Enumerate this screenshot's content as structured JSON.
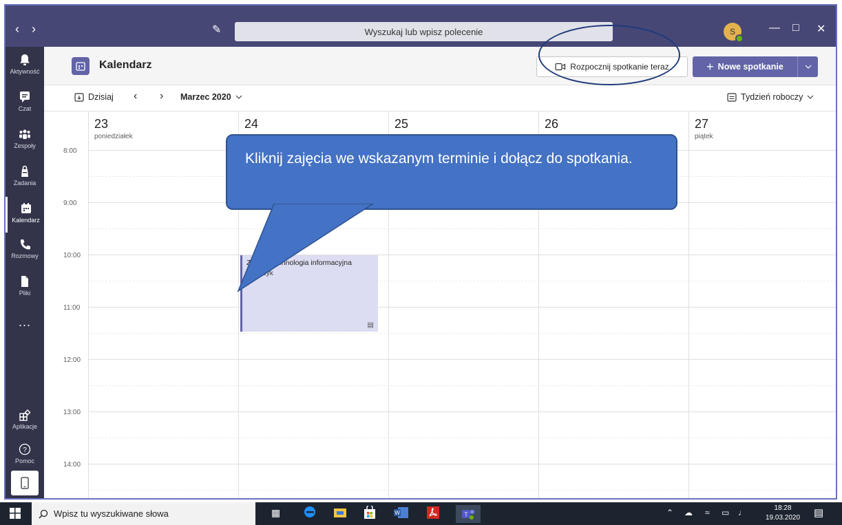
{
  "topbar": {
    "search_placeholder": "Wyszukaj lub wpisz polecenie",
    "avatar_initial": "S"
  },
  "rail": {
    "items": [
      {
        "label": "Aktywność",
        "icon": "bell-icon"
      },
      {
        "label": "Czat",
        "icon": "chat-icon"
      },
      {
        "label": "Zespoły",
        "icon": "teams-icon"
      },
      {
        "label": "Zadania",
        "icon": "assignments-icon"
      },
      {
        "label": "Kalendarz",
        "icon": "calendar-icon"
      },
      {
        "label": "Rozmowy",
        "icon": "phone-icon"
      },
      {
        "label": "Pliki",
        "icon": "file-icon"
      }
    ],
    "more": "...",
    "bottom": [
      {
        "label": "Aplikacje",
        "icon": "apps-icon"
      },
      {
        "label": "Pomoc",
        "icon": "help-icon"
      }
    ]
  },
  "header": {
    "title": "Kalendarz",
    "meet_now": "Rozpocznij spotkanie teraz",
    "new_meeting": "Nowe spotkanie"
  },
  "toolbar": {
    "today": "Dzisiaj",
    "month": "Marzec 2020",
    "view": "Tydzień roboczy"
  },
  "days": [
    {
      "num": "23",
      "name": "poniedziałek"
    },
    {
      "num": "24",
      "name": ""
    },
    {
      "num": "25",
      "name": ""
    },
    {
      "num": "26",
      "name": ""
    },
    {
      "num": "27",
      "name": "piątek"
    }
  ],
  "times": [
    "8:00",
    "9:00",
    "10:00",
    "11:00",
    "12:00",
    "13:00",
    "14:00"
  ],
  "event": {
    "title": "Zajęcia technologia informacyjna",
    "organizer": "stańczyk"
  },
  "callout": {
    "text": "Kliknij zajęcia we wskazanym terminie i dołącz do spotkania."
  },
  "taskbar": {
    "search": "Wpisz tu wyszukiwane słowa",
    "time": "18:28",
    "date": "19.03.2020"
  },
  "colors": {
    "teams_purple": "#6264a7",
    "topbar": "#464775",
    "rail": "#33344a",
    "callout": "#4472c4"
  }
}
